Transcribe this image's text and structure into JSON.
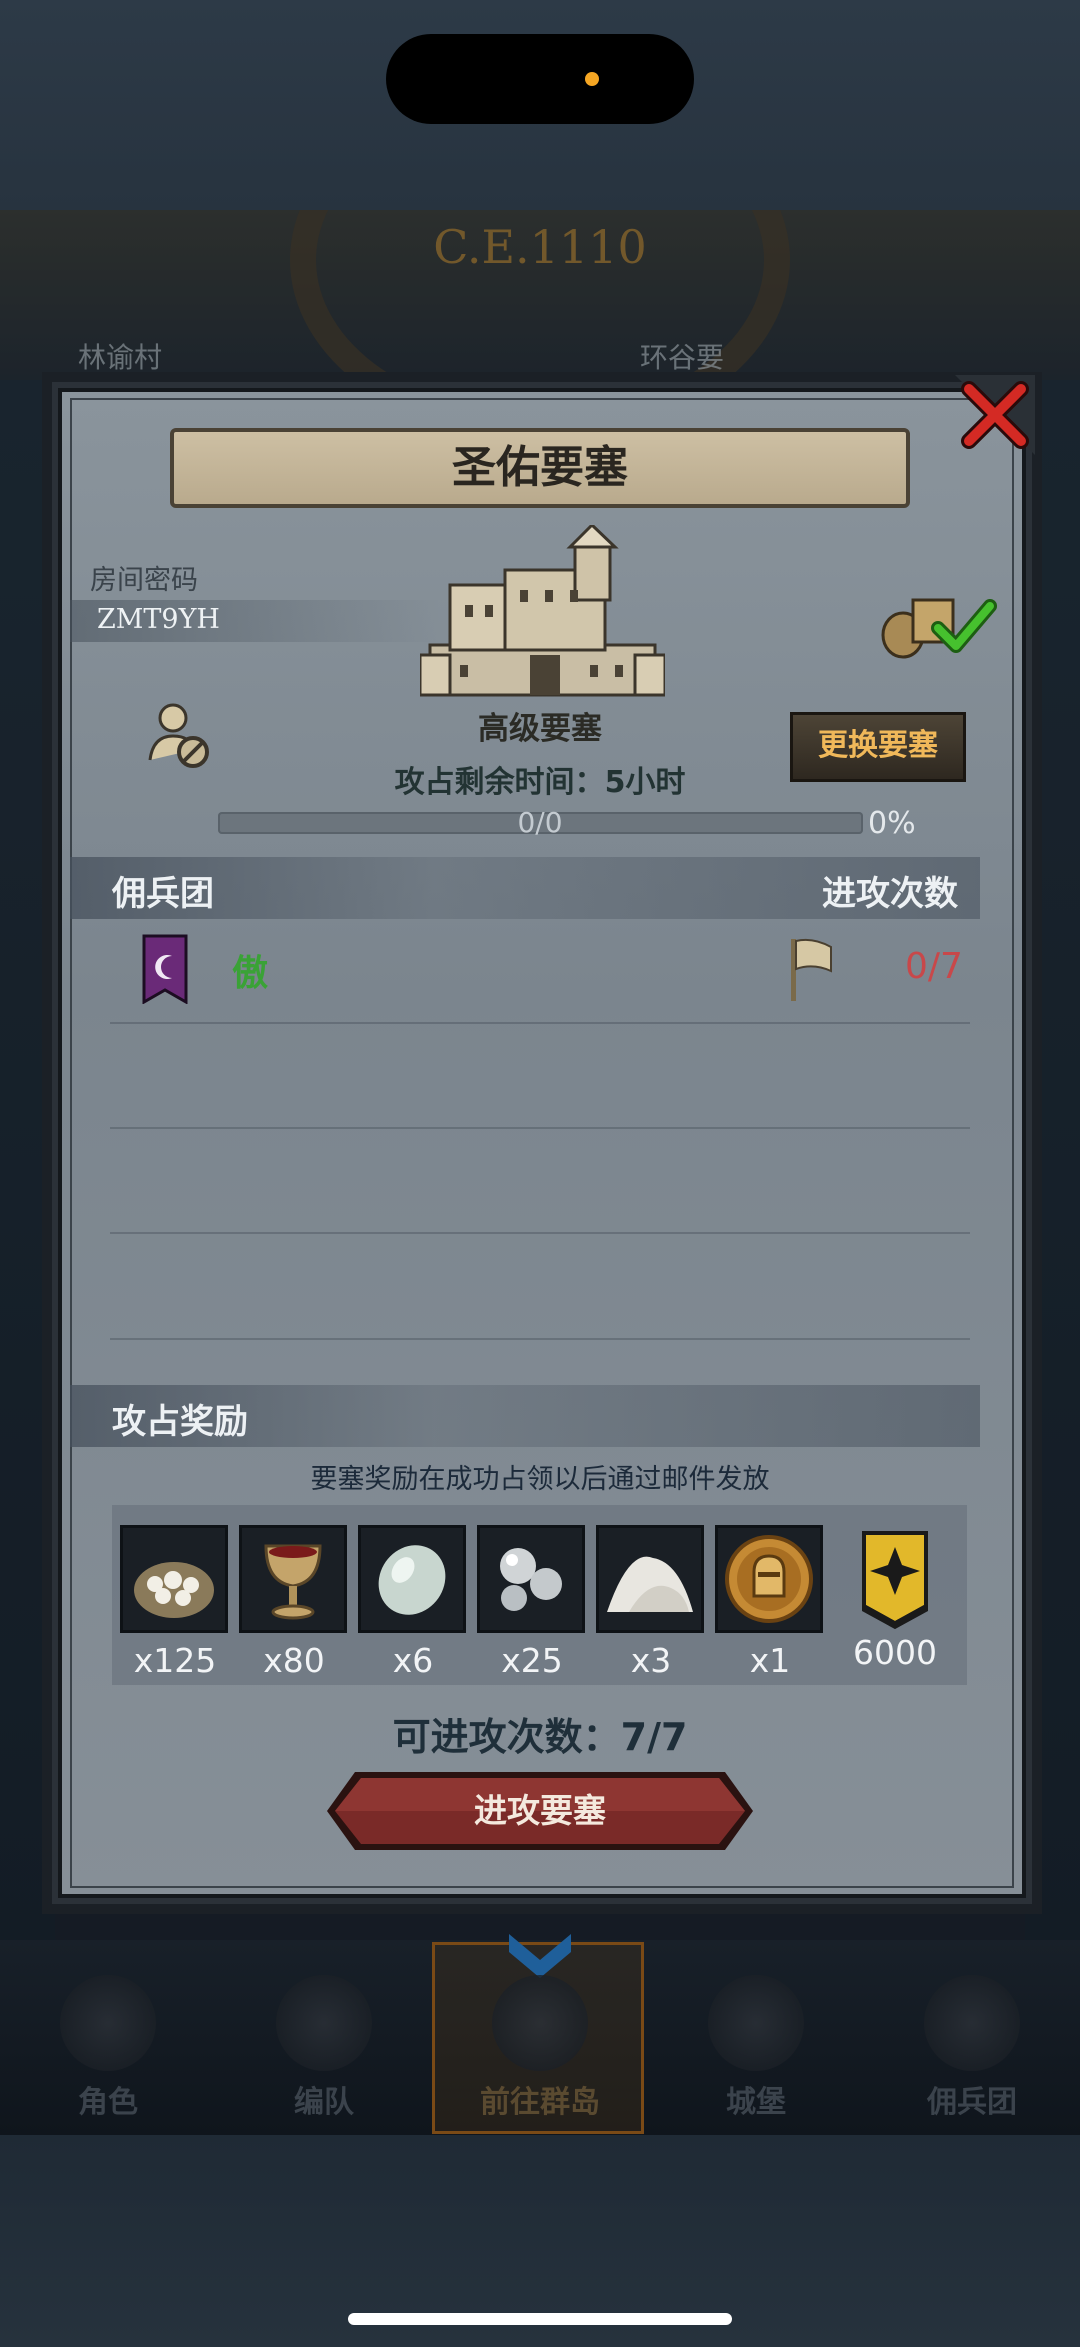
{
  "background": {
    "era": "C.E.1110",
    "villages": [
      "林谕村",
      "环谷要"
    ]
  },
  "modal": {
    "title": "圣佑要塞",
    "room_label": "房间密码",
    "room_code": "ZMT9YH",
    "fortress_type": "高级要塞",
    "change_button": "更换要塞",
    "time_label": "攻占剩余时间：",
    "time_value": "5小时",
    "progress_text": "0/0",
    "progress_percent": "0%",
    "progress_value": 0,
    "mercenary_header": "佣兵团",
    "attacks_header": "进攻次数",
    "mercenary": {
      "name": "傲",
      "attacks": "0/7"
    },
    "rewards_header": "攻占奖励",
    "rewards_note": "要塞奖励在成功占领以后通过邮件发放",
    "rewards": [
      {
        "icon": "silver-ore-sack-icon",
        "qty": "x125"
      },
      {
        "icon": "goblet-icon",
        "qty": "x80"
      },
      {
        "icon": "gem-stone-icon",
        "qty": "x6"
      },
      {
        "icon": "pearls-icon",
        "qty": "x25"
      },
      {
        "icon": "salt-pile-icon",
        "qty": "x3"
      },
      {
        "icon": "knight-medal-icon",
        "qty": "x1"
      },
      {
        "icon": "rank-insignia-icon",
        "qty": "6000"
      }
    ],
    "attempts_label": "可进攻次数：",
    "attempts_value": "7/7",
    "attack_button": "进攻要塞"
  },
  "bottom_nav": [
    {
      "label": "角色"
    },
    {
      "label": "编队"
    },
    {
      "label": "前往群岛",
      "active": true
    },
    {
      "label": "城堡"
    },
    {
      "label": "佣兵团"
    }
  ],
  "colors": {
    "accent_gold": "#f0b85a",
    "mercenary_green": "#3aa236",
    "count_red": "#c8484a",
    "button_red": "#7a2a28"
  }
}
